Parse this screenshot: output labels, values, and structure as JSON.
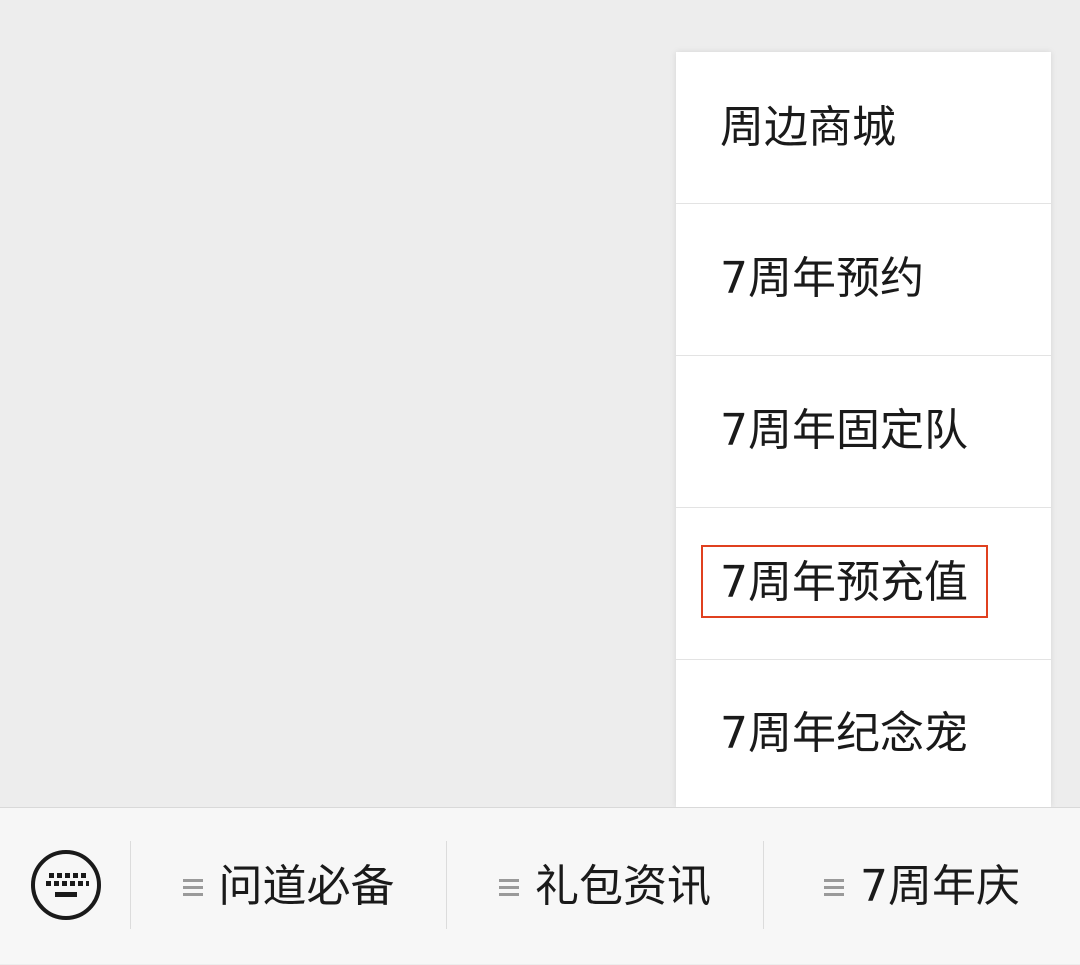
{
  "colors": {
    "backdrop": "#ededed",
    "menu_background": "#ffffff",
    "highlight_border": "#e0401f",
    "bottom_bar": "#f7f7f7",
    "text": "#1a1a1a"
  },
  "popup_menu": {
    "items": [
      {
        "label": "周边商城"
      },
      {
        "label": "7周年预约"
      },
      {
        "label": "7周年固定队"
      },
      {
        "label": "7周年预充值",
        "highlighted": true
      },
      {
        "label": "7周年纪念宠"
      }
    ]
  },
  "bottom_bar": {
    "keyboard_icon": "keyboard-icon",
    "menu_icon": "menu-lines-icon",
    "tabs": [
      {
        "label": "问道必备"
      },
      {
        "label": "礼包资讯"
      },
      {
        "label": "7周年庆"
      }
    ]
  }
}
